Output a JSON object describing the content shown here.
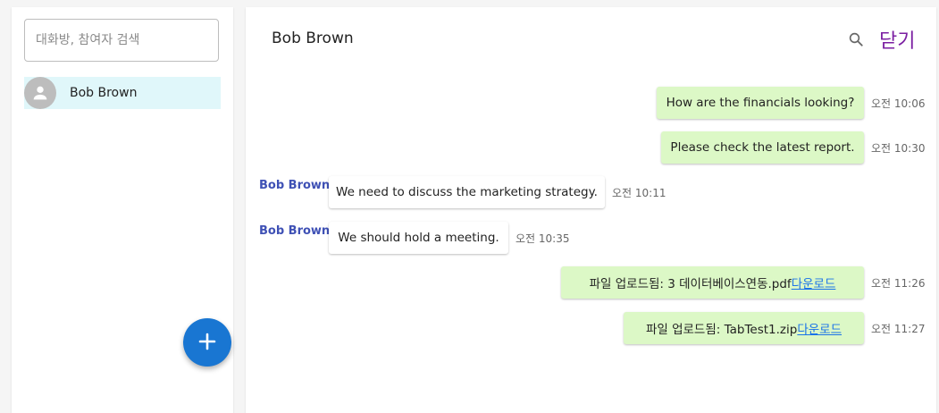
{
  "sidebar": {
    "search_placeholder": "대화방, 참여자 검색",
    "contacts": [
      {
        "name": "Bob Brown",
        "icon": "person-icon"
      }
    ],
    "fab_icon": "plus-icon"
  },
  "chat": {
    "title": "Bob Brown",
    "search_icon": "search-icon",
    "close_label": "닫기",
    "colors": {
      "mine_bubble": "#dcf8c6",
      "sender": "#3f51b5",
      "close": "#7b1fa2",
      "fab": "#1976d2",
      "selected": "#e0f7fa",
      "link": "#1a73e8"
    },
    "messages": [
      {
        "text": "How are the financials looking?",
        "time": "오전 10:06",
        "mine": true
      },
      {
        "text": "Please check the latest report.",
        "time": "오전 10:30",
        "mine": true
      },
      {
        "sender": "Bob Brown",
        "text": "We need to discuss the marketing strategy.",
        "time": "오전 10:11",
        "mine": false
      },
      {
        "sender": "Bob Brown",
        "text": "We should hold a meeting.",
        "time": "오전 10:35",
        "mine": false
      },
      {
        "text": "파일 업로드됨: 3 데이터베이스연동.pdf",
        "link": "다운로드",
        "time": "오전 11:26",
        "mine": true
      },
      {
        "text": "파일 업로드됨: TabTest1.zip",
        "link": "다운로드",
        "time": "오전 11:27",
        "mine": true
      }
    ]
  }
}
